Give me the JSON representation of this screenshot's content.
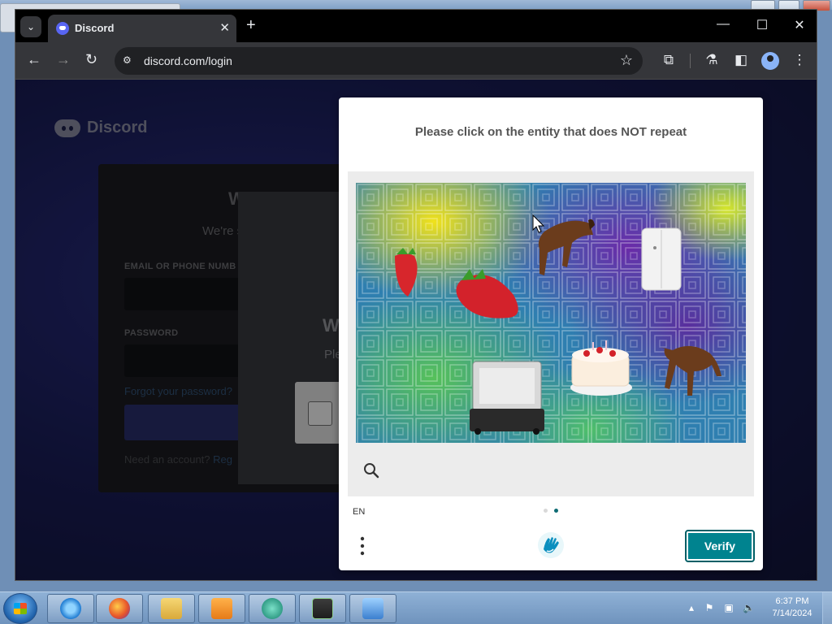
{
  "browser": {
    "tab_title": "Discord",
    "url": "discord.com/login"
  },
  "discord": {
    "logo_text": "Discord",
    "heading_partial": "W",
    "subheading_partial": "We're s",
    "email_label_partial": "EMAIL OR PHONE NUMB",
    "password_label": "PASSWORD",
    "forgot_link_partial": "Forgot your password?",
    "need_account_partial": "Need an account?",
    "register_partial": "Reg",
    "modal_heading_partial": "W",
    "modal_sub_partial": "Ple"
  },
  "captcha": {
    "prompt": "Please click on the entity that does NOT repeat",
    "language": "EN",
    "verify_label": "Verify",
    "page_indicator": {
      "current": 2,
      "total": 2
    },
    "accent_color": "#00838f",
    "objects": [
      "strawberry",
      "strawberry",
      "horse",
      "horse",
      "refrigerator",
      "birthday-cake",
      "suitcase"
    ]
  },
  "taskbar": {
    "time": "6:37 PM",
    "date": "7/14/2024",
    "apps": [
      "internet-explorer-icon",
      "firefox-icon",
      "file-explorer-icon",
      "media-player-icon",
      "app-icon",
      "terminal-icon",
      "control-panel-icon"
    ]
  }
}
